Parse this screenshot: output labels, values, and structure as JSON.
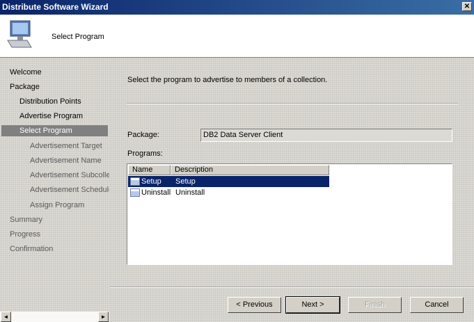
{
  "window": {
    "title": "Distribute Software Wizard",
    "close_glyph": "✕"
  },
  "header": {
    "title": "Select Program",
    "icon": "computer-icon"
  },
  "sidebar": {
    "items": [
      {
        "label": "Welcome"
      },
      {
        "label": "Package"
      },
      {
        "label": "Distribution Points"
      },
      {
        "label": "Advertise Program"
      },
      {
        "label": "Select Program"
      },
      {
        "label": "Advertisement Target"
      },
      {
        "label": "Advertisement Name"
      },
      {
        "label": "Advertisement Subcolle"
      },
      {
        "label": "Advertisement Schedule"
      },
      {
        "label": "Assign Program"
      },
      {
        "label": "Summary"
      },
      {
        "label": "Progress"
      },
      {
        "label": "Confirmation"
      }
    ],
    "selected_index": 4,
    "scroll_left": "◄",
    "scroll_right": "►"
  },
  "main": {
    "instruction": "Select the program to advertise to members of a collection.",
    "package_label": "Package:",
    "package_value": "DB2 Data Server Client",
    "programs_label": "Programs:",
    "columns": [
      "Name",
      "Description"
    ],
    "rows": [
      {
        "name": "Setup",
        "description": "Setup",
        "selected": true
      },
      {
        "name": "Uninstall",
        "description": "Uninstall",
        "selected": false
      }
    ]
  },
  "buttons": {
    "previous": "< Previous",
    "next": "Next >",
    "finish": "Finish",
    "cancel": "Cancel"
  },
  "colors": {
    "title_bar": "#0a246a",
    "selection": "#0a246a",
    "sidebar_selected": "#808080"
  }
}
